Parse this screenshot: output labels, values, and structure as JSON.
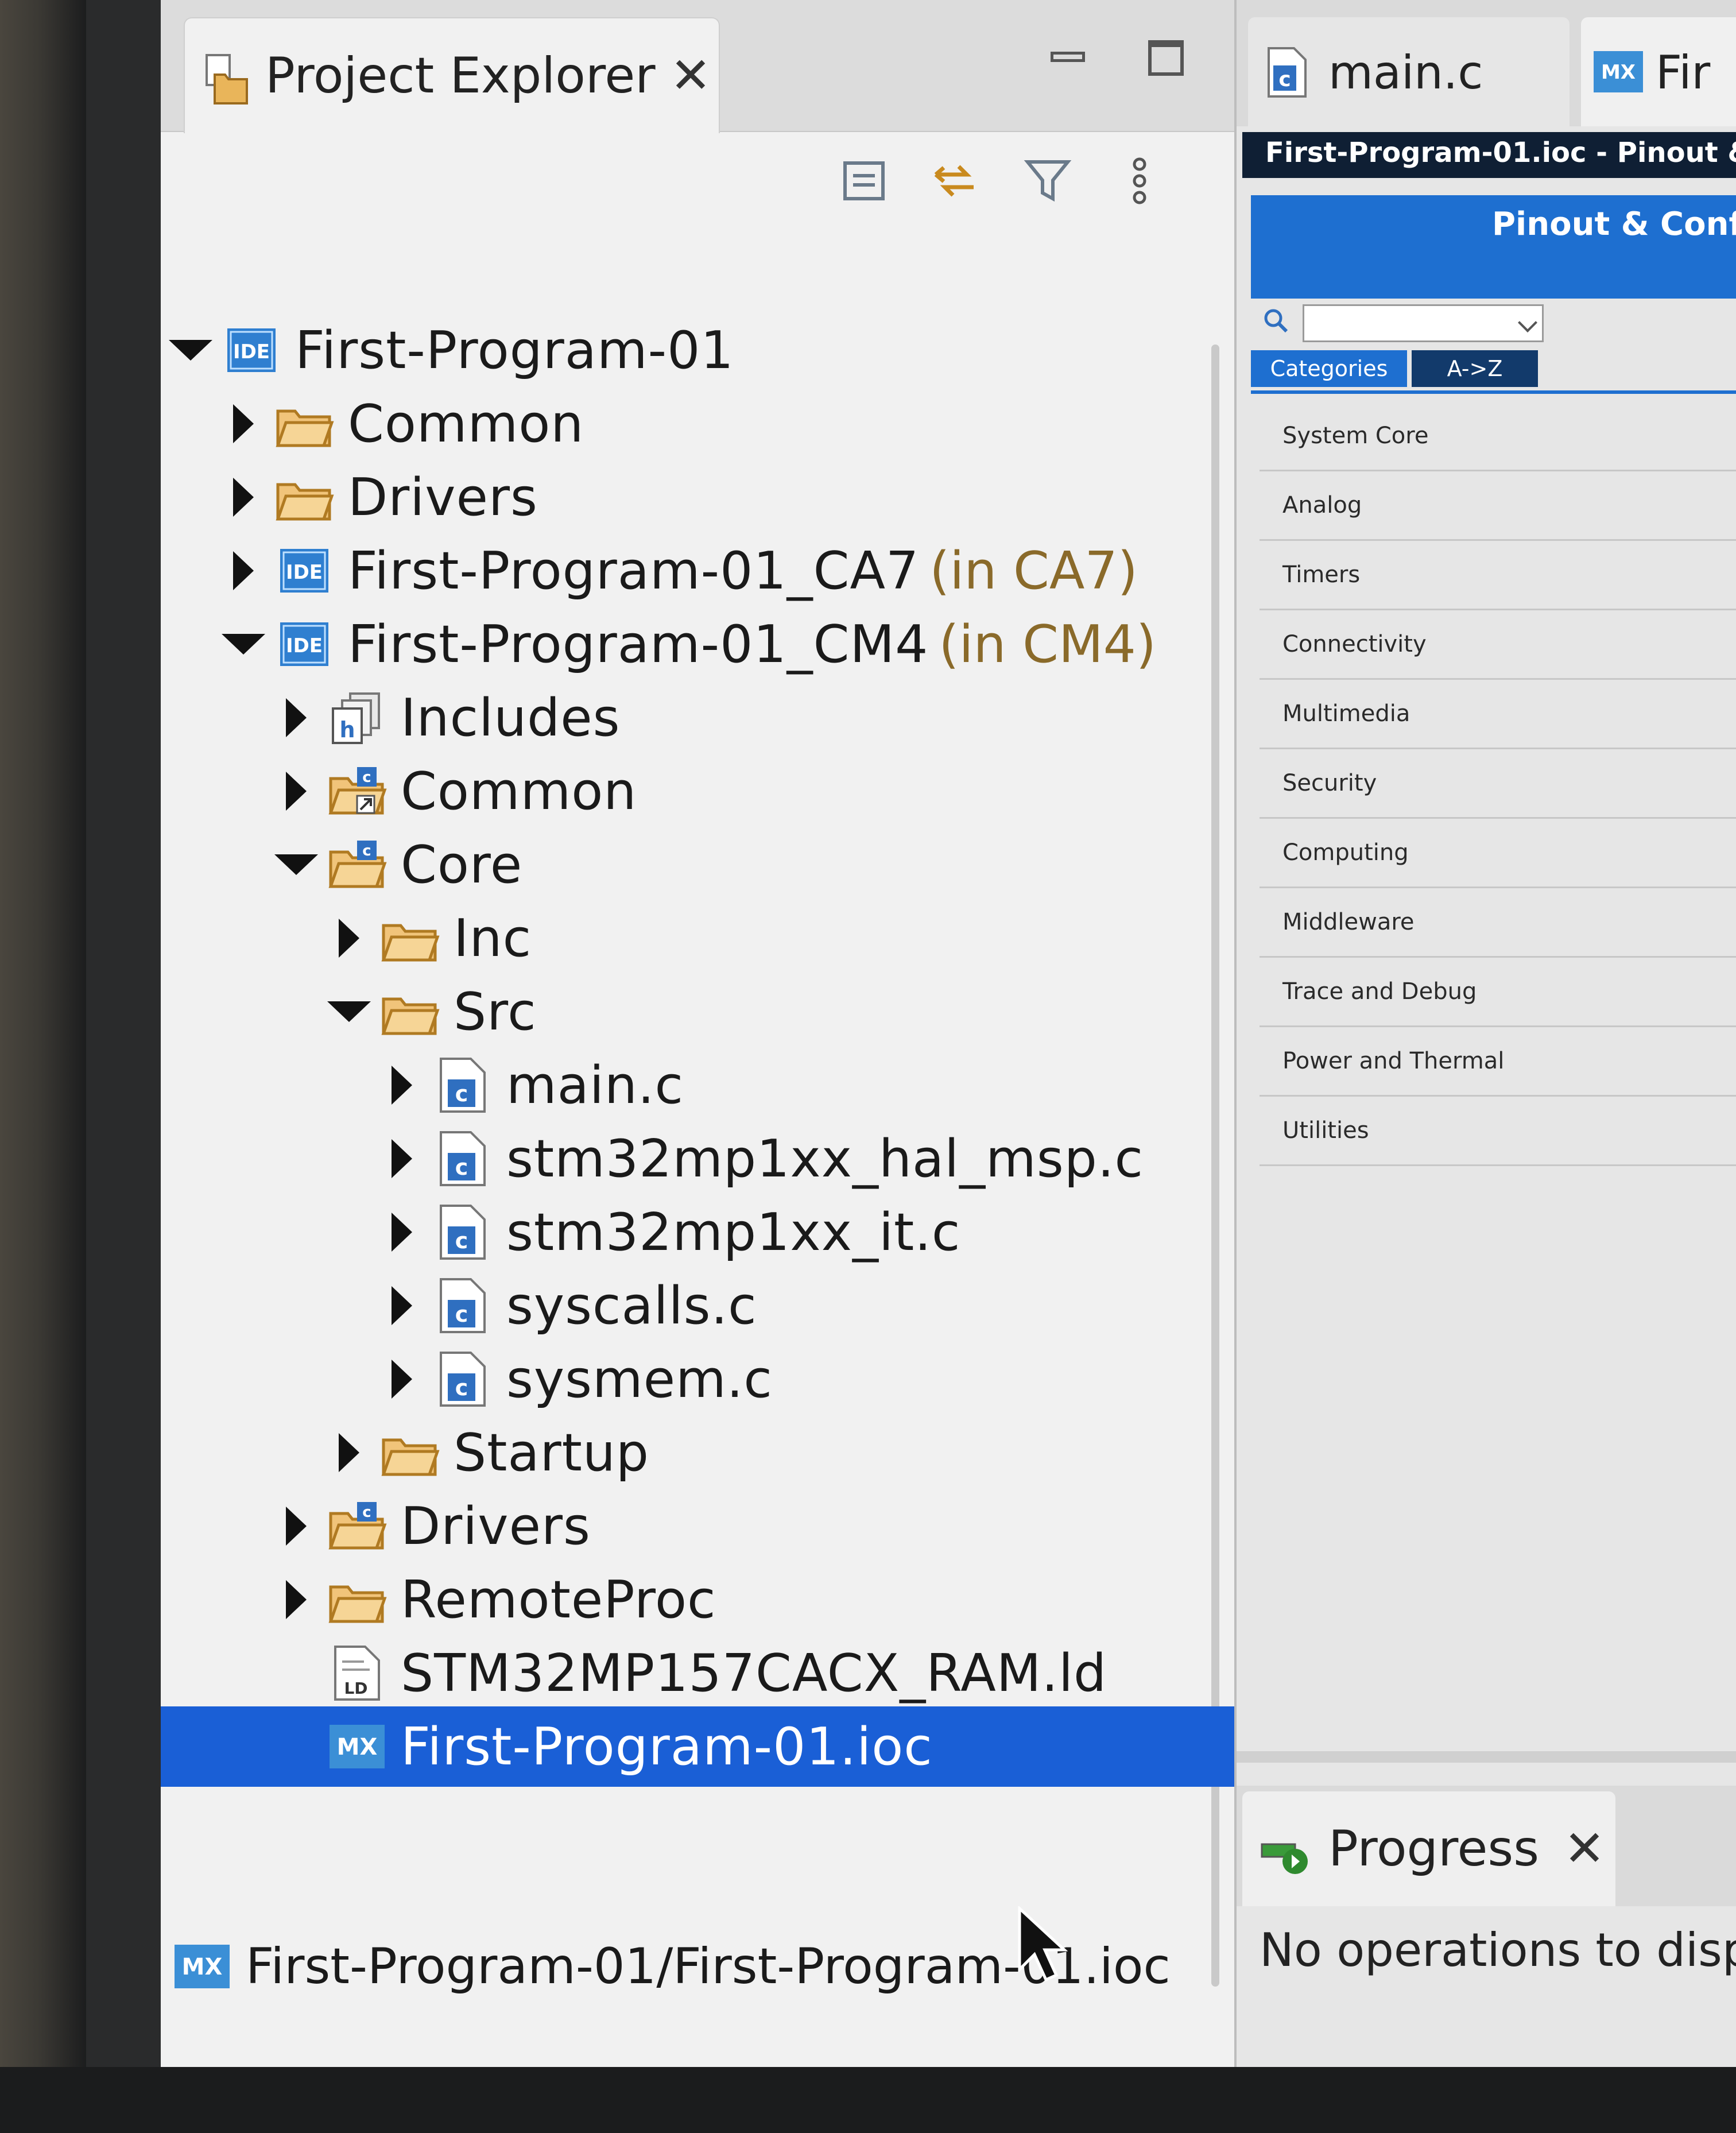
{
  "project_explorer": {
    "tab_title": "Project Explorer",
    "tab_close": "✕",
    "tree": [
      {
        "label": "First-Program-01",
        "tag": "",
        "depth": 0,
        "twisty": "down",
        "icon": "ide-project-icon"
      },
      {
        "label": "Common",
        "tag": "",
        "depth": 1,
        "twisty": "right",
        "icon": "folder-icon"
      },
      {
        "label": "Drivers",
        "tag": "",
        "depth": 1,
        "twisty": "right",
        "icon": "folder-icon"
      },
      {
        "label": "First-Program-01_CA7",
        "tag": "(in CA7)",
        "depth": 1,
        "twisty": "right",
        "icon": "ide-project-icon"
      },
      {
        "label": "First-Program-01_CM4",
        "tag": "(in CM4)",
        "depth": 1,
        "twisty": "down",
        "icon": "ide-project-icon"
      },
      {
        "label": "Includes",
        "tag": "",
        "depth": 2,
        "twisty": "right",
        "icon": "includes-icon"
      },
      {
        "label": "Common",
        "tag": "",
        "depth": 2,
        "twisty": "right",
        "icon": "linked-source-folder-icon"
      },
      {
        "label": "Core",
        "tag": "",
        "depth": 2,
        "twisty": "down",
        "icon": "source-folder-icon"
      },
      {
        "label": "Inc",
        "tag": "",
        "depth": 3,
        "twisty": "right",
        "icon": "folder-icon"
      },
      {
        "label": "Src",
        "tag": "",
        "depth": 3,
        "twisty": "down",
        "icon": "folder-icon"
      },
      {
        "label": "main.c",
        "tag": "",
        "depth": 4,
        "twisty": "right",
        "icon": "c-file-icon"
      },
      {
        "label": "stm32mp1xx_hal_msp.c",
        "tag": "",
        "depth": 4,
        "twisty": "right",
        "icon": "c-file-icon"
      },
      {
        "label": "stm32mp1xx_it.c",
        "tag": "",
        "depth": 4,
        "twisty": "right",
        "icon": "c-file-icon"
      },
      {
        "label": "syscalls.c",
        "tag": "",
        "depth": 4,
        "twisty": "right",
        "icon": "c-file-icon"
      },
      {
        "label": "sysmem.c",
        "tag": "",
        "depth": 4,
        "twisty": "right",
        "icon": "c-file-icon"
      },
      {
        "label": "Startup",
        "tag": "",
        "depth": 3,
        "twisty": "right",
        "icon": "folder-icon"
      },
      {
        "label": "Drivers",
        "tag": "",
        "depth": 2,
        "twisty": "right",
        "icon": "source-folder-icon"
      },
      {
        "label": "RemoteProc",
        "tag": "",
        "depth": 2,
        "twisty": "right",
        "icon": "folder-icon"
      },
      {
        "label": "STM32MP157CACX_RAM.ld",
        "tag": "",
        "depth": 2,
        "twisty": "none",
        "icon": "linker-script-icon"
      },
      {
        "label": "First-Program-01.ioc",
        "tag": "",
        "depth": 2,
        "twisty": "none",
        "icon": "mx-file-icon",
        "selected": true
      }
    ],
    "status_path": "First-Program-01/First-Program-01.ioc"
  },
  "editor": {
    "tab_main_label": "main.c",
    "tab_mx_label": "Fir",
    "title": "First-Program-01.ioc - Pinout &",
    "banner": "Pinout & Conf",
    "search_value": "",
    "view_tabs": {
      "categories": "Categories",
      "az": "A->Z"
    },
    "categories": [
      "System Core",
      "Analog",
      "Timers",
      "Connectivity",
      "Multimedia",
      "Security",
      "Computing",
      "Middleware",
      "Trace and Debug",
      "Power and Thermal",
      "Utilities"
    ]
  },
  "progress": {
    "tab_label": "Progress",
    "tab_close": "✕",
    "message": "No operations to disp"
  },
  "colors": {
    "selection": "#1a5fd6",
    "banner": "#1e6fd0",
    "title_bar": "#0f1f34",
    "tag_text": "#8a6a2a"
  }
}
